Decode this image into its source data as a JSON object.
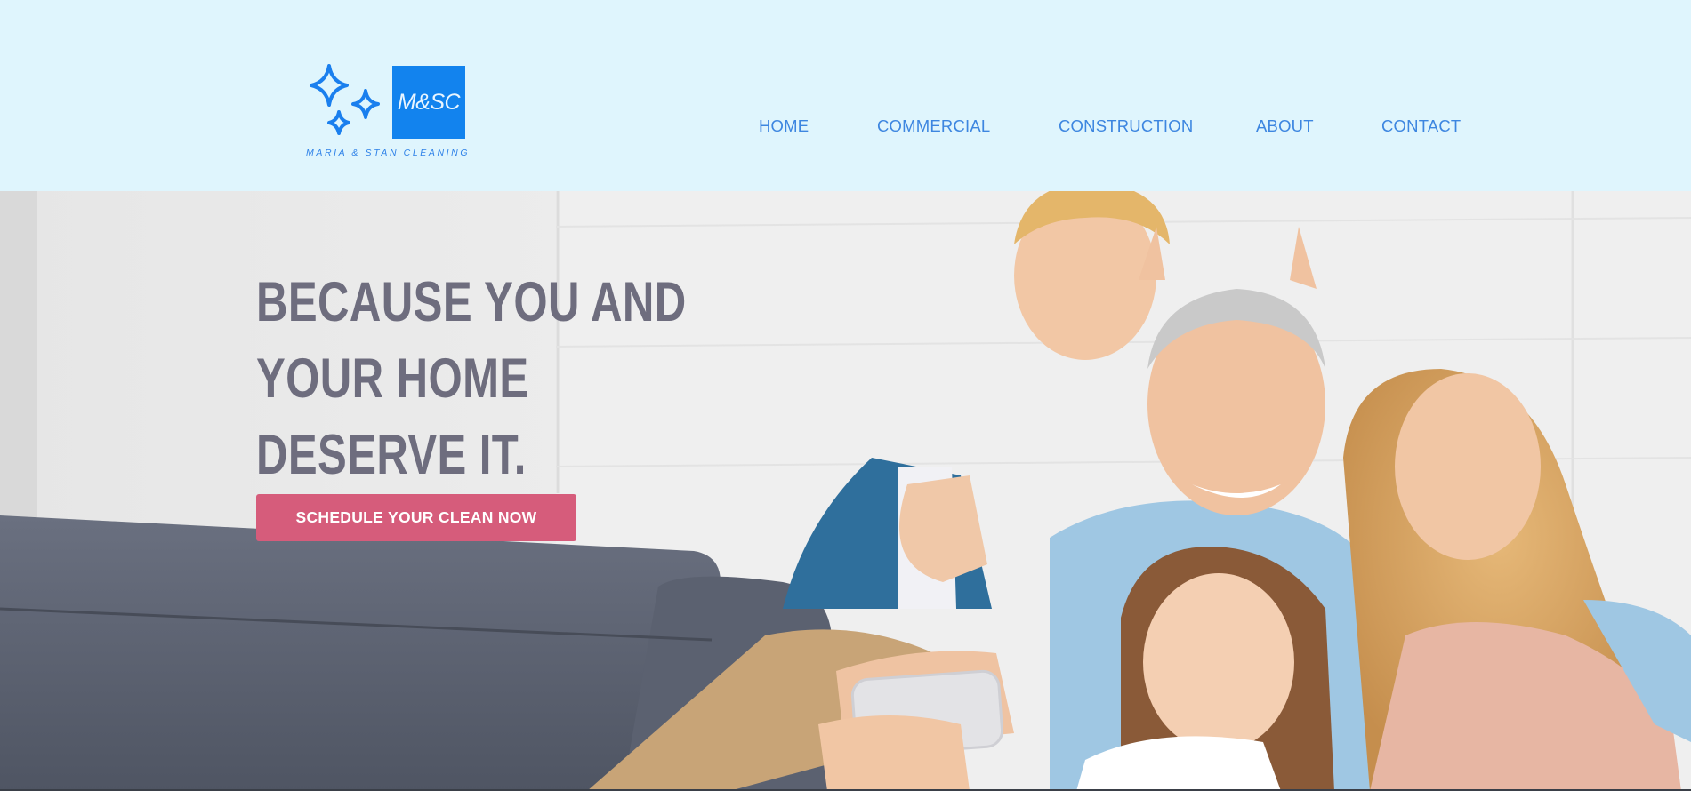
{
  "logo": {
    "monogram": "M&SC",
    "tagline": "MARIA & STAN CLEANING",
    "icon": "sparkles-icon"
  },
  "nav": {
    "items": [
      {
        "label": "HOME"
      },
      {
        "label": "COMMERCIAL"
      },
      {
        "label": "CONSTRUCTION"
      },
      {
        "label": "ABOUT"
      },
      {
        "label": "CONTACT"
      }
    ]
  },
  "hero": {
    "headline_lines": [
      "BECAUSE YOU AND",
      "YOUR HOME",
      "DESERVE IT."
    ],
    "cta_label": "SCHEDULE YOUR CLEAN NOW",
    "image_alt": "family-selfie-photo"
  },
  "colors": {
    "header_bg": "#dff5fd",
    "brand_blue": "#1283ee",
    "nav_text": "#3d86e0",
    "headline": "#6e6d7e",
    "cta_bg": "#d65c7b"
  }
}
